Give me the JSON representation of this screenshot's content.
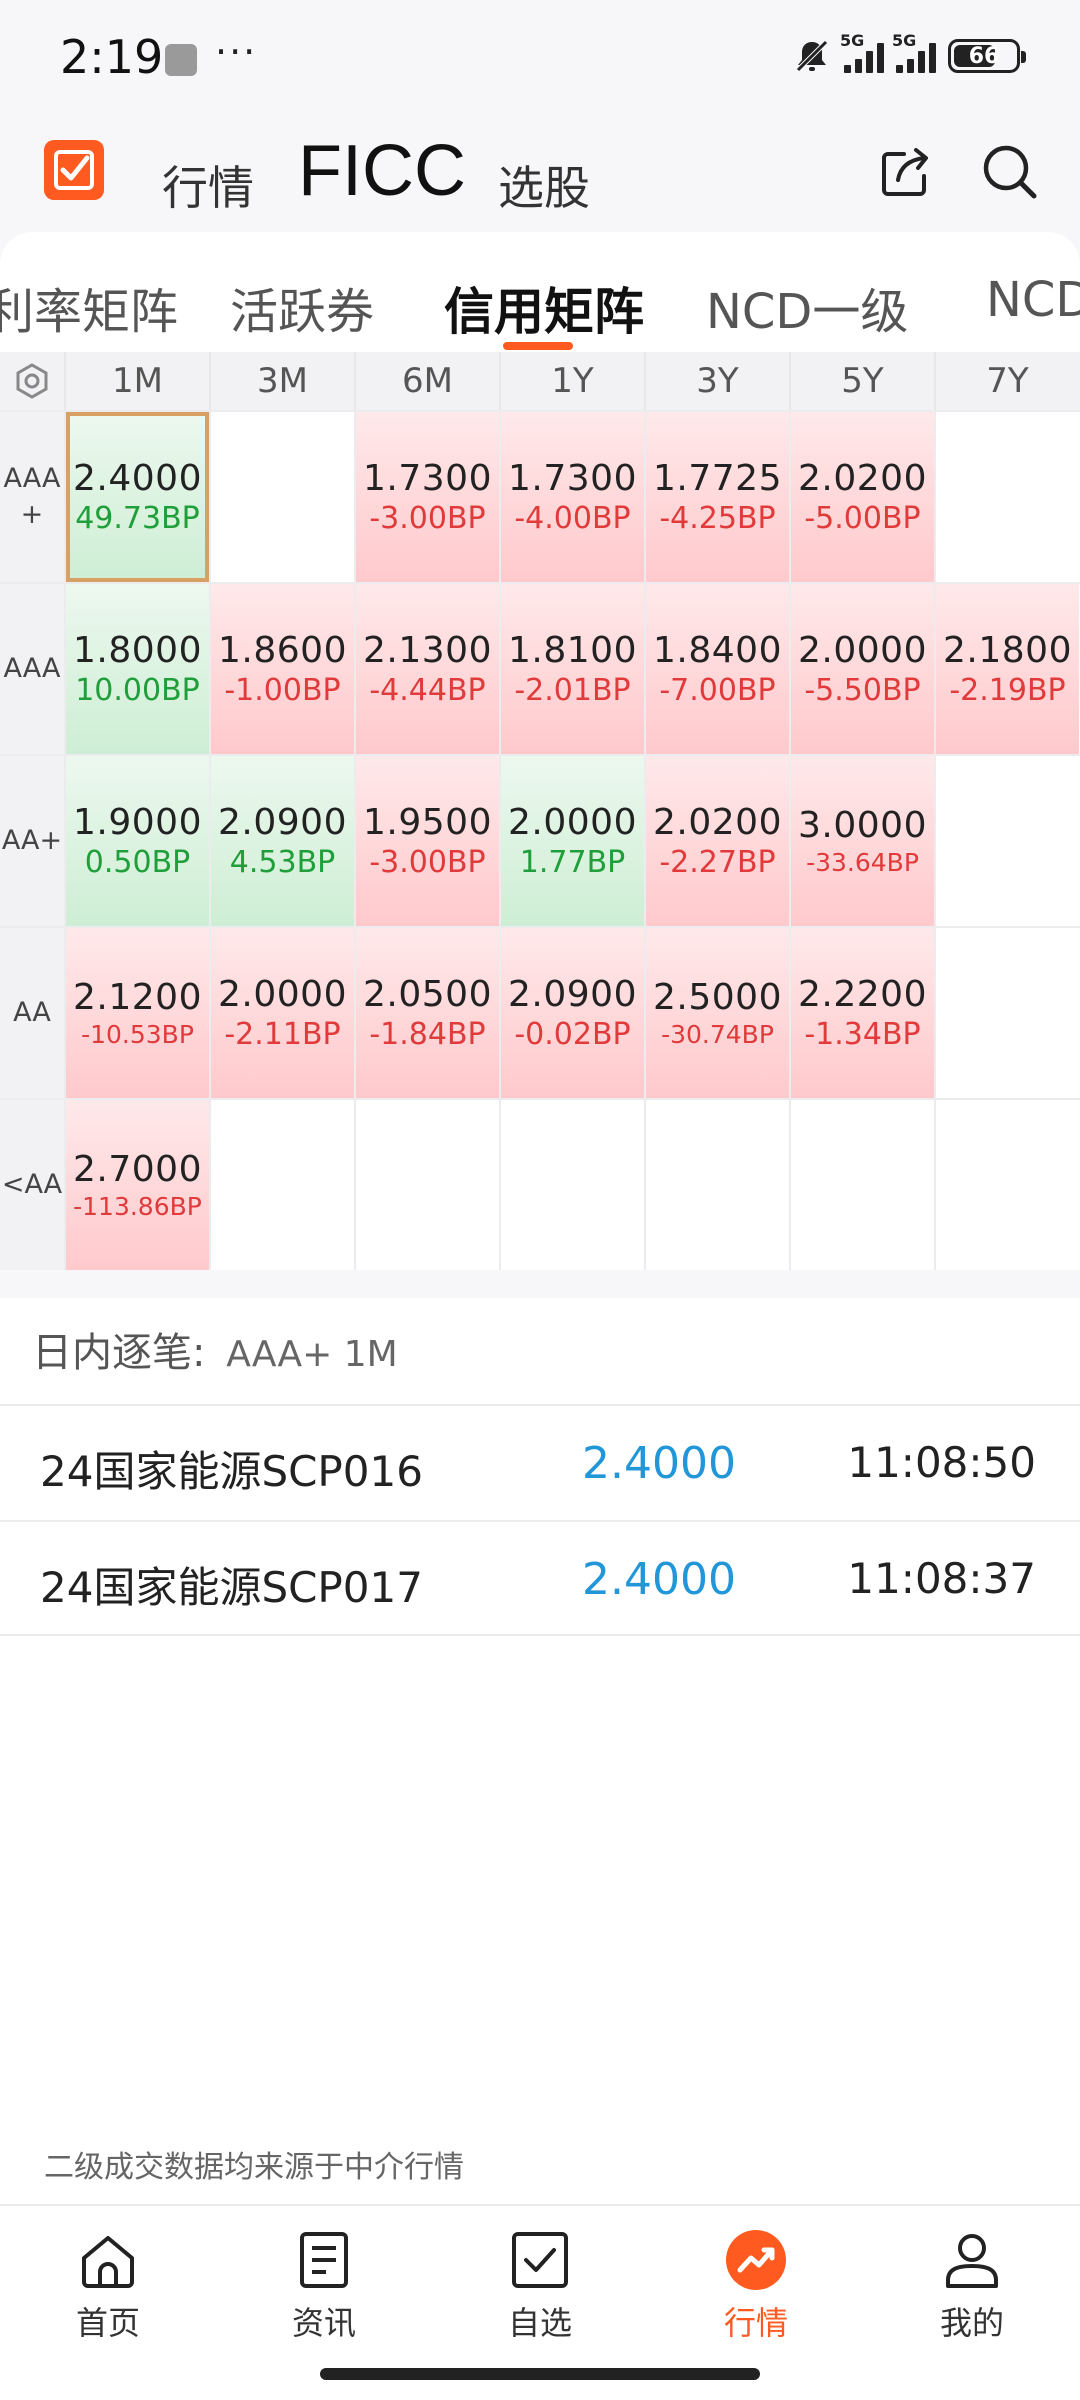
{
  "status_bar": {
    "time": "2:19",
    "more": "···",
    "signal1_label": "5G",
    "signal2_label": "5G",
    "battery": "66"
  },
  "header": {
    "tab_quotes": "行情",
    "tab_ficc": "FICC",
    "tab_stocks": "选股"
  },
  "sub_tabs": [
    "利率矩阵",
    "活跃券",
    "信用矩阵",
    "NCD一级",
    "NCD"
  ],
  "matrix": {
    "columns": [
      "1M",
      "3M",
      "6M",
      "1Y",
      "3Y",
      "5Y",
      "7Y"
    ],
    "rows": [
      {
        "label": "AAA\n+",
        "cells": [
          {
            "v": "2.4000",
            "d": "49.73BP",
            "t": "green",
            "sel": true
          },
          {
            "v": "",
            "d": "",
            "t": "empty"
          },
          {
            "v": "1.7300",
            "d": "-3.00BP",
            "t": "red"
          },
          {
            "v": "1.7300",
            "d": "-4.00BP",
            "t": "red"
          },
          {
            "v": "1.7725",
            "d": "-4.25BP",
            "t": "red"
          },
          {
            "v": "2.0200",
            "d": "-5.00BP",
            "t": "red"
          },
          {
            "v": "",
            "d": "",
            "t": "empty"
          }
        ]
      },
      {
        "label": "AAA",
        "cells": [
          {
            "v": "1.8000",
            "d": "10.00BP",
            "t": "green"
          },
          {
            "v": "1.8600",
            "d": "-1.00BP",
            "t": "red"
          },
          {
            "v": "2.1300",
            "d": "-4.44BP",
            "t": "red"
          },
          {
            "v": "1.8100",
            "d": "-2.01BP",
            "t": "red"
          },
          {
            "v": "1.8400",
            "d": "-7.00BP",
            "t": "red"
          },
          {
            "v": "2.0000",
            "d": "-5.50BP",
            "t": "red"
          },
          {
            "v": "2.1800",
            "d": "-2.19BP",
            "t": "red"
          }
        ]
      },
      {
        "label": "AA+",
        "cells": [
          {
            "v": "1.9000",
            "d": "0.50BP",
            "t": "green"
          },
          {
            "v": "2.0900",
            "d": "4.53BP",
            "t": "green"
          },
          {
            "v": "1.9500",
            "d": "-3.00BP",
            "t": "red"
          },
          {
            "v": "2.0000",
            "d": "1.77BP",
            "t": "green"
          },
          {
            "v": "2.0200",
            "d": "-2.27BP",
            "t": "red"
          },
          {
            "v": "3.0000",
            "d": "-33.64BP",
            "t": "red"
          },
          {
            "v": "",
            "d": "",
            "t": "empty"
          }
        ]
      },
      {
        "label": "AA",
        "cells": [
          {
            "v": "2.1200",
            "d": "-10.53BP",
            "t": "red"
          },
          {
            "v": "2.0000",
            "d": "-2.11BP",
            "t": "red"
          },
          {
            "v": "2.0500",
            "d": "-1.84BP",
            "t": "red"
          },
          {
            "v": "2.0900",
            "d": "-0.02BP",
            "t": "red"
          },
          {
            "v": "2.5000",
            "d": "-30.74BP",
            "t": "red"
          },
          {
            "v": "2.2200",
            "d": "-1.34BP",
            "t": "red"
          },
          {
            "v": "",
            "d": "",
            "t": "empty"
          }
        ]
      },
      {
        "label": "<AA",
        "cells": [
          {
            "v": "2.7000",
            "d": "-113.86BP",
            "t": "red"
          },
          {
            "v": "",
            "d": "",
            "t": "empty"
          },
          {
            "v": "",
            "d": "",
            "t": "empty"
          },
          {
            "v": "",
            "d": "",
            "t": "empty"
          },
          {
            "v": "",
            "d": "",
            "t": "empty"
          },
          {
            "v": "",
            "d": "",
            "t": "empty"
          },
          {
            "v": "",
            "d": "",
            "t": "empty"
          }
        ]
      }
    ]
  },
  "intraday": {
    "title": "日内逐笔:",
    "selection": "AAA+ 1M",
    "trades": [
      {
        "name": "24国家能源SCP016",
        "price": "2.4000",
        "time": "11:08:50"
      },
      {
        "name": "24国家能源SCP017",
        "price": "2.4000",
        "time": "11:08:37"
      }
    ]
  },
  "footnote": "二级成交数据均来源于中介行情",
  "bottom_nav": [
    {
      "label": "首页",
      "icon": "home-icon"
    },
    {
      "label": "资讯",
      "icon": "news-icon"
    },
    {
      "label": "自选",
      "icon": "watchlist-icon"
    },
    {
      "label": "行情",
      "icon": "market-trend-icon",
      "active": true
    },
    {
      "label": "我的",
      "icon": "profile-icon"
    }
  ],
  "colors": {
    "accent": "#ff5a1f",
    "up": "#e03a3a",
    "down": "#1f9e3a",
    "price_blue": "#2196d9"
  }
}
